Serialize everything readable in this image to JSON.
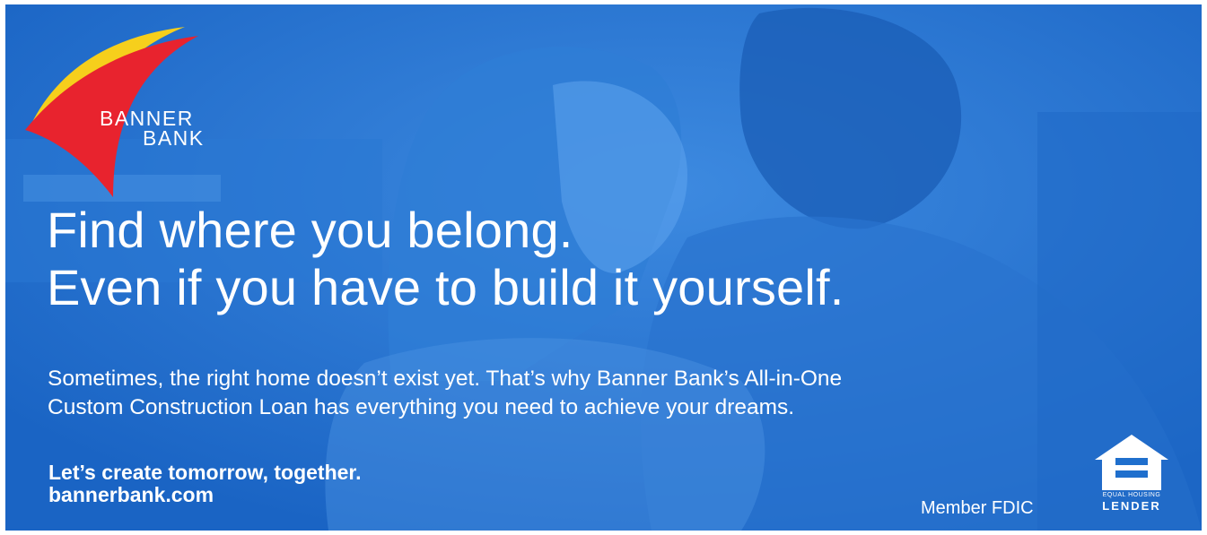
{
  "brand": {
    "name_line1": "BANNER",
    "name_line2": "BANK",
    "colors": {
      "background_blue": "#1f6fcd",
      "sail_red": "#e8232e",
      "sail_yellow": "#f6cf1c",
      "text": "#ffffff"
    }
  },
  "headline": {
    "line1": "Find where you belong.",
    "line2": "Even if you have to build it yourself."
  },
  "body": {
    "line1": "Sometimes, the right home doesn’t exist yet. That’s why Banner Bank’s All-in-One",
    "line2": "Custom Construction Loan has everything you need to achieve your dreams."
  },
  "footer": {
    "tagline": "Let’s create tomorrow, together.",
    "website": "bannerbank.com",
    "fdic": "Member FDIC",
    "ehl_small": "EQUAL HOUSING",
    "ehl_big": "LENDER"
  },
  "icons": {
    "logo": "banner-bank-sail-logo",
    "equal_housing": "equal-housing-lender-icon"
  }
}
